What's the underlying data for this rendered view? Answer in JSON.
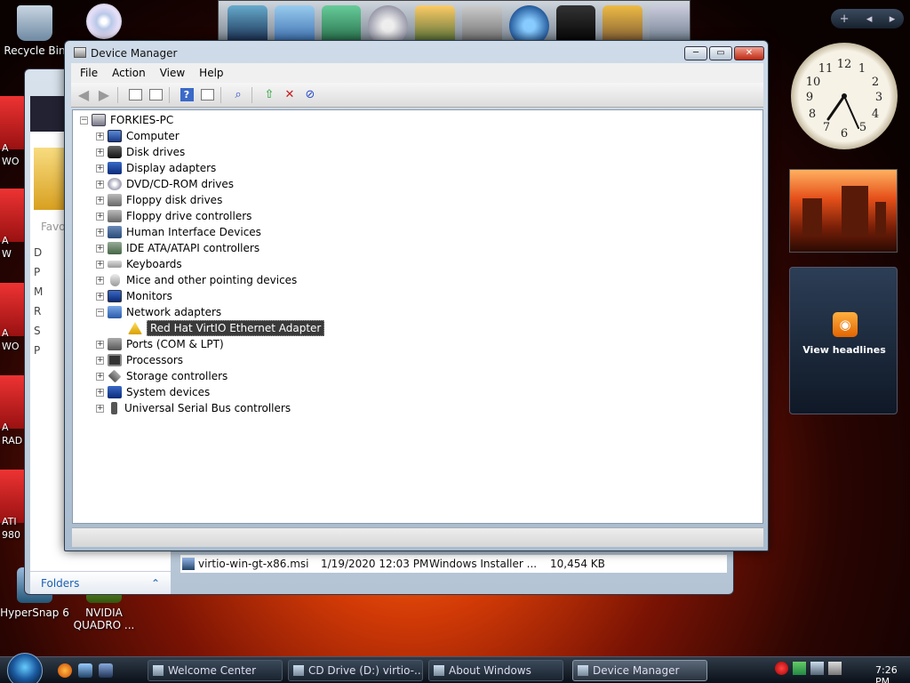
{
  "desktop": {
    "icons": [
      {
        "label": "Recycle Bin"
      },
      {
        "label": "HyperSnap 6"
      },
      {
        "label": "NVIDIA QUADRO ..."
      }
    ],
    "ati_labels": [
      "A",
      "WO",
      "A",
      "W",
      "A",
      "WO",
      "A",
      "RAD",
      "ATI",
      "980"
    ]
  },
  "sidebar": {
    "controls": [
      "+",
      "◂",
      "▸"
    ],
    "feed_label": "View headlines"
  },
  "explorer": {
    "favorites_label": "Favo",
    "nav_letters": [
      "D",
      "P",
      "M",
      "R",
      "S",
      "P"
    ],
    "folders_label": "Folders",
    "file": {
      "name": "virtio-win-gt-x86.msi",
      "date": "1/19/2020 12:03 PM",
      "type": "Windows Installer ...",
      "size": "10,454 KB"
    }
  },
  "device_manager": {
    "title": "Device Manager",
    "menu": [
      "File",
      "Action",
      "View",
      "Help"
    ],
    "root": "FORKIES-PC",
    "categories": [
      {
        "label": "Computer",
        "icon": "computer-icon",
        "expanded": false
      },
      {
        "label": "Disk drives",
        "icon": "disk-drive-icon",
        "expanded": false
      },
      {
        "label": "Display adapters",
        "icon": "display-adapter-icon",
        "expanded": false
      },
      {
        "label": "DVD/CD-ROM drives",
        "icon": "dvd-drive-icon",
        "expanded": false
      },
      {
        "label": "Floppy disk drives",
        "icon": "floppy-drive-icon",
        "expanded": false
      },
      {
        "label": "Floppy drive controllers",
        "icon": "floppy-controller-icon",
        "expanded": false
      },
      {
        "label": "Human Interface Devices",
        "icon": "hid-icon",
        "expanded": false
      },
      {
        "label": "IDE ATA/ATAPI controllers",
        "icon": "ide-controller-icon",
        "expanded": false
      },
      {
        "label": "Keyboards",
        "icon": "keyboard-icon",
        "expanded": false
      },
      {
        "label": "Mice and other pointing devices",
        "icon": "mouse-icon",
        "expanded": false
      },
      {
        "label": "Monitors",
        "icon": "monitor-icon",
        "expanded": false
      },
      {
        "label": "Network adapters",
        "icon": "network-adapter-icon",
        "expanded": true
      },
      {
        "label": "Ports (COM & LPT)",
        "icon": "port-icon",
        "expanded": false
      },
      {
        "label": "Processors",
        "icon": "processor-icon",
        "expanded": false
      },
      {
        "label": "Storage controllers",
        "icon": "storage-controller-icon",
        "expanded": false
      },
      {
        "label": "System devices",
        "icon": "system-device-icon",
        "expanded": false
      },
      {
        "label": "Universal Serial Bus controllers",
        "icon": "usb-icon",
        "expanded": false
      }
    ],
    "network_child": {
      "label": "Red Hat VirtIO Ethernet Adapter",
      "icon": "warning-device-icon",
      "selected": true
    },
    "window_buttons": {
      "minimize": "─",
      "maximize": "▭",
      "close": "✕"
    }
  },
  "taskbar": {
    "buttons": [
      "Welcome Center",
      "CD Drive (D:) virtio-...",
      "About Windows",
      "Device Manager"
    ],
    "active": "Device Manager",
    "time": "7:26 PM"
  },
  "colors": {
    "selection_bg": "#3a3a3a",
    "titlebar_glass": "#cfdbe8"
  }
}
